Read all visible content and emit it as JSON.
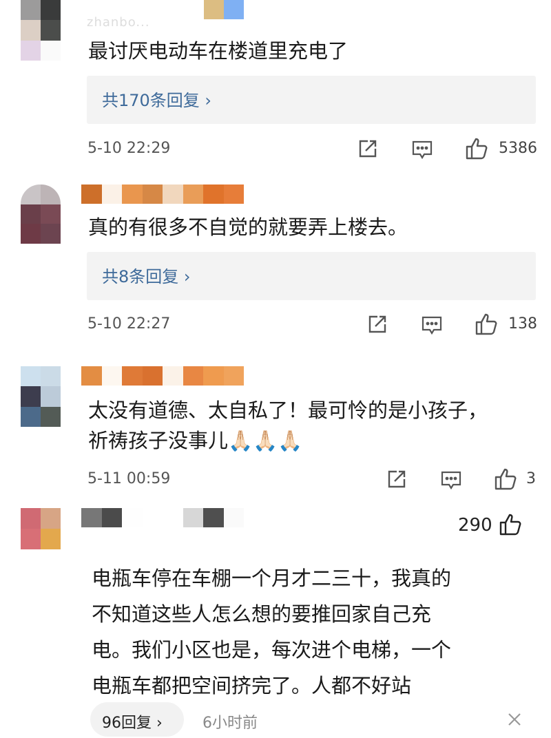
{
  "comments": [
    {
      "text": "最讨厌电动车在楼道里充电了",
      "replies_label": "共170条回复 ›",
      "timestamp": "5-10 22:29",
      "likes": "5386",
      "username": "zhanbo..."
    },
    {
      "text": "真的有很多不自觉的就要弄上楼去。",
      "replies_label": "共8条回复 ›",
      "timestamp": "5-10 22:27",
      "likes": "138"
    },
    {
      "text_line1": "太没有道德、太自私了！最可怜的是小孩子，",
      "text_line2": "祈祷孩子没事儿🙏🏻🙏🏻🙏🏻",
      "timestamp": "5-11 00:59",
      "likes": "3"
    },
    {
      "likes": "290",
      "line1": "电瓶车停在车棚一个月才二三十，我真的",
      "line2": "不知道这些人怎么想的要推回家自己充",
      "line3": "电。我们小区也是，每次进个电梯，一个",
      "line4": "电瓶车都把空间挤完了。人都不好站",
      "replies_label": "96回复 ›",
      "time_ago": "6小时前"
    }
  ],
  "icons": {
    "share": "share-icon",
    "comment": "comment-icon",
    "like": "thumbs-up-icon",
    "close": "close-icon"
  }
}
